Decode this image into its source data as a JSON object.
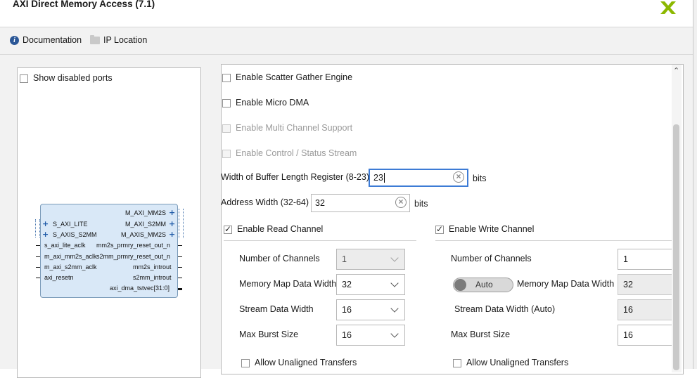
{
  "window": {
    "title": "AXI Direct Memory Access (7.1)"
  },
  "toolbar": {
    "documentation": "Documentation",
    "ip_location": "IP Location"
  },
  "left": {
    "show_disabled_ports": "Show disabled ports",
    "block": {
      "left_bus_ports": [
        "S_AXI_LITE",
        "S_AXIS_S2MM"
      ],
      "left_ports": [
        "s_axi_lite_aclk",
        "m_axi_mm2s_aclk",
        "m_axi_s2mm_aclk",
        "axi_resetn"
      ],
      "right_bus_ports": [
        "M_AXI_MM2S",
        "M_AXI_S2MM",
        "M_AXIS_MM2S"
      ],
      "right_ports": [
        "mm2s_prmry_reset_out_n",
        "s2mm_prmry_reset_out_n",
        "mm2s_introut",
        "s2mm_introut",
        "axi_dma_tstvec[31:0]"
      ]
    }
  },
  "options": {
    "scatter_gather": "Enable Scatter Gather Engine",
    "micro_dma": "Enable Micro DMA",
    "multi_channel": "Enable Multi Channel Support",
    "control_status": "Enable Control / Status Stream",
    "buffer_length_label": "Width of Buffer Length Register (8-23)",
    "buffer_length_value": "23",
    "buffer_length_unit": "bits",
    "address_width_label": "Address Width (32-64)",
    "address_width_value": "32",
    "address_width_unit": "bits"
  },
  "read": {
    "enable": "Enable Read Channel",
    "channels_label": "Number of Channels",
    "channels_value": "1",
    "mm_width_label": "Memory Map Data Width",
    "mm_width_value": "32",
    "stream_width_label": "Stream Data Width",
    "stream_width_value": "16",
    "burst_label": "Max Burst Size",
    "burst_value": "16",
    "unaligned": "Allow Unaligned Transfers"
  },
  "write": {
    "enable": "Enable Write Channel",
    "channels_label": "Number of Channels",
    "channels_value": "1",
    "auto_toggle": "Auto",
    "mm_width_label": "Memory Map Data Width",
    "mm_width_value": "32",
    "stream_width_label": "Stream Data Width (Auto)",
    "stream_width_value": "16",
    "burst_label": "Max Burst Size",
    "burst_value": "16",
    "unaligned": "Allow Unaligned Transfers"
  },
  "colors": {
    "accent": "#3d7bd5",
    "ip_block": "#d9e8f7",
    "logo": "#8cb800"
  }
}
